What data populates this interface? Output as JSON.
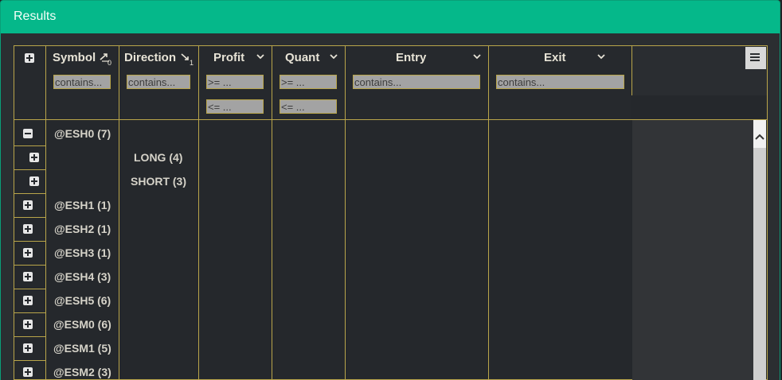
{
  "window": {
    "title": "Results"
  },
  "columns": [
    {
      "label": "Symbol",
      "sort_index": "0",
      "filter_placeholder": "contains..."
    },
    {
      "label": "Direction",
      "sort_index": "1",
      "filter_placeholder": "contains..."
    },
    {
      "label": "Profit",
      "filter_min_placeholder": ">= ...",
      "filter_max_placeholder": "<= ..."
    },
    {
      "label": "Quant",
      "filter_min_placeholder": ">= ...",
      "filter_max_placeholder": "<= ..."
    },
    {
      "label": "Entry",
      "filter_placeholder": "contains..."
    },
    {
      "label": "Exit",
      "filter_placeholder": "contains..."
    }
  ],
  "rows": [
    {
      "symbol": "@ESH0 (7)",
      "direction": "",
      "expanded": true
    },
    {
      "symbol": "",
      "direction": "LONG (4)",
      "expanded": false
    },
    {
      "symbol": "",
      "direction": "SHORT (3)",
      "expanded": false
    },
    {
      "symbol": "@ESH1 (1)",
      "direction": "",
      "expanded": false
    },
    {
      "symbol": "@ESH2 (1)",
      "direction": "",
      "expanded": false
    },
    {
      "symbol": "@ESH3 (1)",
      "direction": "",
      "expanded": false
    },
    {
      "symbol": "@ESH4 (3)",
      "direction": "",
      "expanded": false
    },
    {
      "symbol": "@ESH5 (6)",
      "direction": "",
      "expanded": false
    },
    {
      "symbol": "@ESM0 (6)",
      "direction": "",
      "expanded": false
    },
    {
      "symbol": "@ESM1 (5)",
      "direction": "",
      "expanded": false
    },
    {
      "symbol": "@ESM2 (3)",
      "direction": "",
      "expanded": false
    }
  ],
  "colors": {
    "title_bar": "#05b88a",
    "grid_border": "#b9a54a",
    "background": "#25282c",
    "text": "#d6d3c9"
  },
  "icons": [
    "expand-all-icon",
    "sort-ascending-icon",
    "chevron-down-icon",
    "menu-icon",
    "collapse-icon",
    "expand-icon",
    "scroll-up-icon"
  ]
}
